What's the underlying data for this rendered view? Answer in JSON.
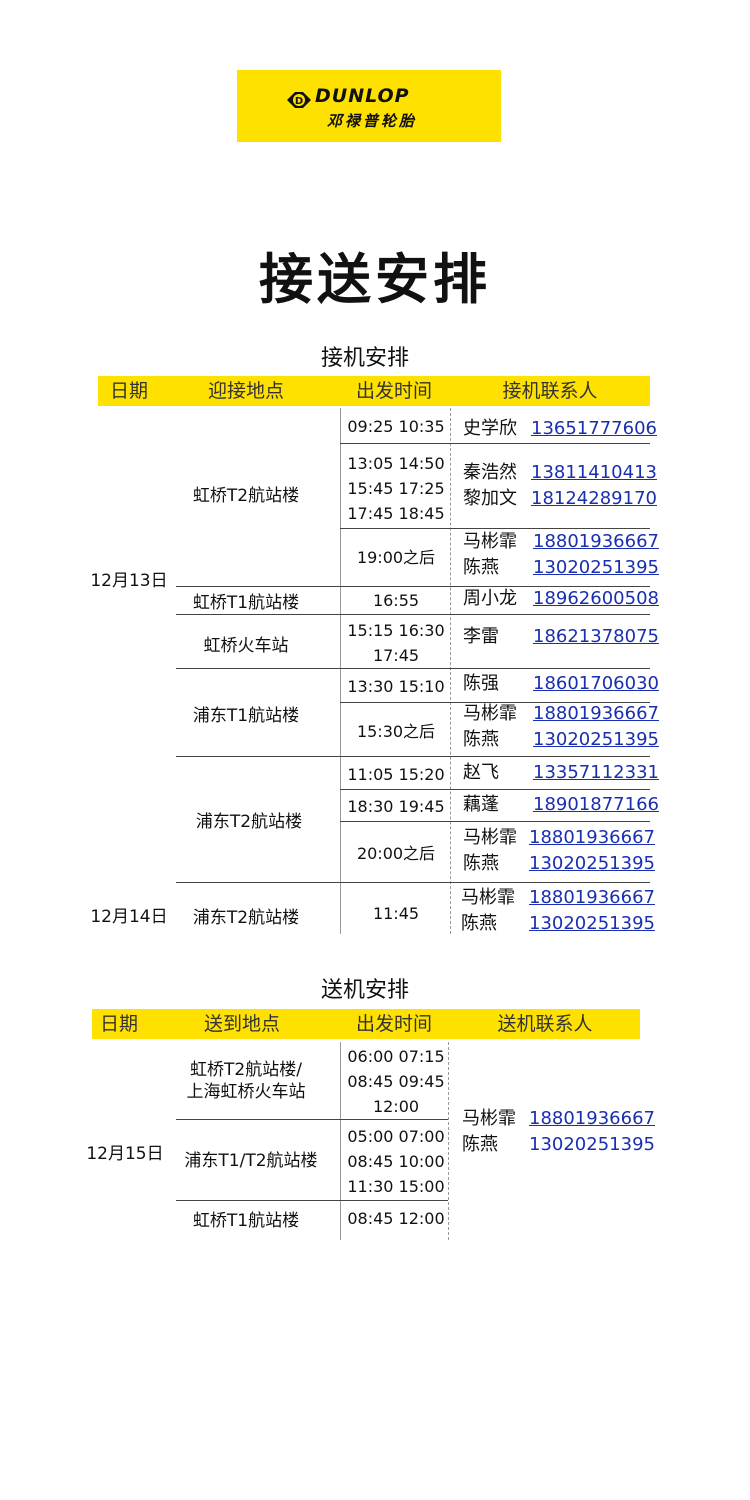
{
  "logo": {
    "brand": "DUNLOP",
    "brand_cn": "邓禄普轮胎"
  },
  "title": "接送安排",
  "pickup": {
    "title": "接机安排",
    "headers": [
      "日期",
      "迎接地点",
      "出发时间",
      "接机联系人"
    ],
    "dates": [
      "12月13日",
      "12月14日"
    ],
    "locations": [
      "虹桥T2航站楼",
      "虹桥T1航站楼",
      "虹桥火车站",
      "浦东T1航站楼",
      "浦东T2航站楼",
      "浦东T2航站楼"
    ],
    "times": [
      [
        "09:25  10:35"
      ],
      [
        "13:05  14:50",
        "15:45  17:25",
        "17:45  18:45"
      ],
      [
        "19:00之后"
      ],
      [
        "16:55"
      ],
      [
        "15:15  16:30",
        "17:45"
      ],
      [
        "13:30  15:10"
      ],
      [
        "15:30之后"
      ],
      [
        "11:05  15:20"
      ],
      [
        "18:30  19:45"
      ],
      [
        "20:00之后"
      ],
      [
        "11:45"
      ]
    ],
    "contacts": [
      [
        {
          "name": "史学欣",
          "phone": "13651777606"
        }
      ],
      [
        {
          "name": "秦浩然",
          "phone": "13811410413"
        },
        {
          "name": "黎加文",
          "phone": "18124289170"
        }
      ],
      [
        {
          "name": "马彬霏",
          "phone": "18801936667"
        },
        {
          "name": "陈燕",
          "phone": "13020251395"
        }
      ],
      [
        {
          "name": "周小龙",
          "phone": "18962600508"
        }
      ],
      [
        {
          "name": "李雷",
          "phone": "18621378075"
        }
      ],
      [
        {
          "name": "陈强",
          "phone": "18601706030"
        }
      ],
      [
        {
          "name": "马彬霏",
          "phone": "18801936667"
        },
        {
          "name": "陈燕",
          "phone": "13020251395"
        }
      ],
      [
        {
          "name": "赵飞",
          "phone": "13357112331"
        }
      ],
      [
        {
          "name": "藕蓬",
          "phone": "18901877166"
        }
      ],
      [
        {
          "name": "马彬霏",
          "phone": "18801936667"
        },
        {
          "name": "陈燕",
          "phone": "13020251395"
        }
      ],
      [
        {
          "name": "马彬霏",
          "phone": "18801936667"
        },
        {
          "name": "陈燕",
          "phone": "13020251395"
        }
      ]
    ]
  },
  "dropoff": {
    "title": "送机安排",
    "headers": [
      "日期",
      "送到地点",
      "出发时间",
      "送机联系人"
    ],
    "date": "12月15日",
    "locations": [
      [
        "虹桥T2航站楼/",
        "上海虹桥火车站"
      ],
      [
        "浦东T1/T2航站楼"
      ],
      [
        "虹桥T1航站楼"
      ]
    ],
    "times": [
      [
        "06:00  07:15",
        "08:45  09:45",
        "12:00"
      ],
      [
        "05:00  07:00",
        "08:45  10:00",
        "11:30  15:00"
      ],
      [
        "08:45  12:00"
      ]
    ],
    "contacts": [
      {
        "name": "马彬霏",
        "phone": "18801936667"
      },
      {
        "name": "陈燕",
        "phone": "13020251395"
      }
    ]
  },
  "colors": {
    "accent": "#ffe100",
    "link": "#1a2fb0"
  }
}
